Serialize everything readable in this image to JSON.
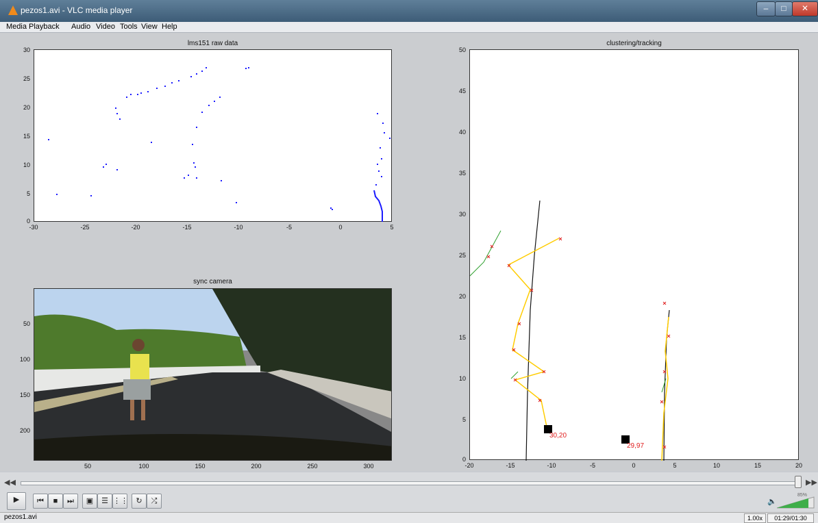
{
  "window": {
    "title": "pezos1.avi - VLC media player"
  },
  "menu": [
    "Media",
    "Playback",
    "Audio",
    "Video",
    "Tools",
    "View",
    "Help"
  ],
  "plots": {
    "raw": {
      "title": "lms151 raw data",
      "xticks": [
        "-30",
        "-25",
        "-20",
        "-15",
        "-10",
        "-5",
        "0",
        "5"
      ],
      "yticks": [
        "30",
        "25",
        "20",
        "15",
        "10",
        "5",
        "0"
      ]
    },
    "camera": {
      "title": "sync camera",
      "xticks": [
        "50",
        "100",
        "150",
        "200",
        "250",
        "300"
      ],
      "yticks": [
        "50",
        "100",
        "150",
        "200"
      ]
    },
    "tracking": {
      "title": "clustering/tracking",
      "xticks": [
        "-20",
        "-15",
        "-10",
        "-5",
        "0",
        "5",
        "10",
        "15",
        "20"
      ],
      "yticks": [
        "50",
        "45",
        "40",
        "35",
        "30",
        "25",
        "20",
        "15",
        "10",
        "5",
        "0"
      ],
      "labels": [
        "30,20",
        "29,97"
      ]
    }
  },
  "status": {
    "file": "pezos1.avi",
    "speed": "1.00x",
    "time": "01:29/01:30",
    "volume": "85%"
  },
  "colors": {
    "accent": "#f08a1c",
    "scatter": "#1a1aff",
    "track": "#ffcc00",
    "marker": "#e02020"
  }
}
